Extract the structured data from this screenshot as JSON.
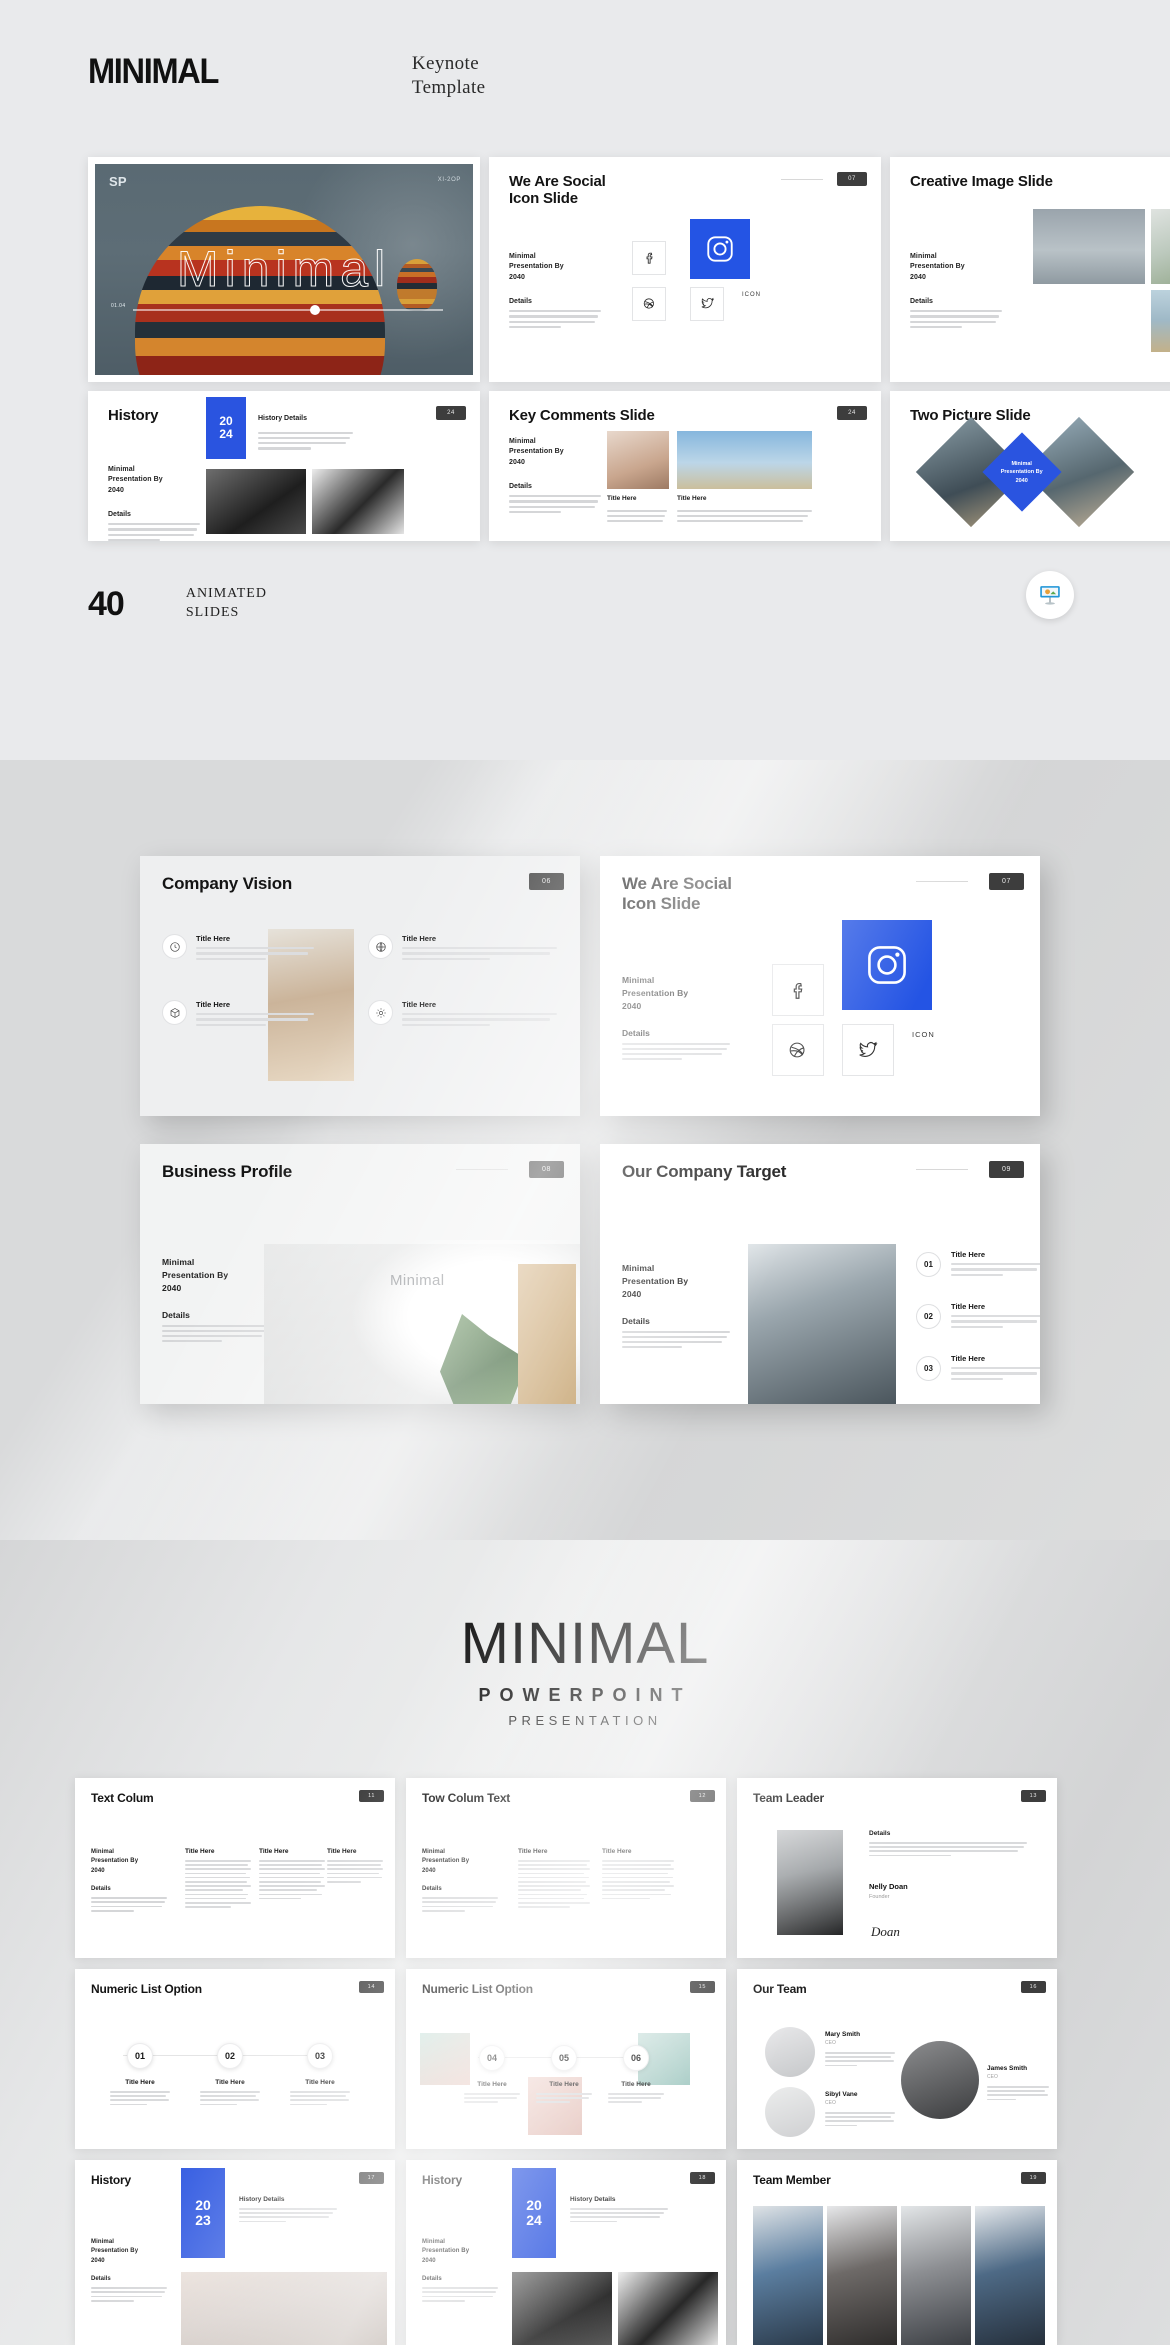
{
  "brand": {
    "wordmark": "MINIMAL",
    "subtitle_line1": "Keynote",
    "subtitle_line2": "Template"
  },
  "keynote_section": {
    "cover": {
      "tag": "SP",
      "code": "XI-2OP",
      "word": "Minimal",
      "slider_label": "01.04"
    },
    "footer": {
      "count": "40",
      "label_line1": "ANIMATED",
      "label_line2": "SLIDES",
      "app_icon": "keynote-app-icon"
    },
    "slides": [
      {
        "title_line1": "We Are Social",
        "title_line2": "Icon Slide",
        "number": "07",
        "meta_by": "Minimal\nPresentation By\n2040",
        "meta_details": "Details",
        "icon_label": "ICON",
        "icons": [
          "facebook-icon",
          "instagram-icon",
          "dribbble-icon",
          "twitter-icon"
        ]
      },
      {
        "title_line1": "Creative Image Slide",
        "title_line2": "",
        "number": "",
        "meta_by": "Minimal\nPresentation By\n2040",
        "meta_details": "Details"
      },
      {
        "title_line1": "History",
        "title_line2": "",
        "number": "24",
        "year_top": "20",
        "year_bottom": "24",
        "detail_title": "History Details",
        "meta_by": "Minimal\nPresentation By\n2040",
        "meta_details": "Details"
      },
      {
        "title_line1": "Key Comments Slide",
        "title_line2": "",
        "number": "24",
        "meta_by": "Minimal\nPresentation By\n2040",
        "meta_details": "Details",
        "caption_left": "Title Here",
        "caption_right": "Title Here"
      },
      {
        "title_line1": "Two Picture Slide",
        "title_line2": "",
        "number": "",
        "diamond_label": "Minimal\nPresentation By\n2040"
      }
    ]
  },
  "mockup_section": {
    "cards": [
      {
        "title": "Company Vision",
        "number": "06",
        "features": [
          {
            "icon": "clock-icon",
            "title": "Title Here"
          },
          {
            "icon": "globe-icon",
            "title": "Title Here"
          },
          {
            "icon": "box-icon",
            "title": "Title Here"
          },
          {
            "icon": "gear-icon",
            "title": "Title Here"
          }
        ]
      },
      {
        "title_line1": "We Are Social",
        "title_line2": "Icon Slide",
        "number": "07",
        "meta_by": "Minimal\nPresentation By\n2040",
        "meta_details": "Details",
        "icon_label": "ICON",
        "icons": [
          "facebook-icon",
          "instagram-icon",
          "dribbble-icon",
          "twitter-icon"
        ]
      },
      {
        "title": "Business Profile",
        "number": "08",
        "meta_by": "Minimal\nPresentation By\n2040",
        "meta_details": "Details",
        "watermark": "Minimal"
      },
      {
        "title": "Our Company Target",
        "number": "09",
        "meta_by": "Minimal\nPresentation By\n2040",
        "meta_details": "Details",
        "rows": [
          {
            "num": "01",
            "title": "Title Here"
          },
          {
            "num": "02",
            "title": "Title Here"
          },
          {
            "num": "03",
            "title": "Title Here"
          }
        ]
      }
    ]
  },
  "powerpoint_section": {
    "title": "MINIMAL",
    "subtitle1": "POWERPOINT",
    "subtitle2": "PRESENTATION",
    "slides": [
      {
        "title": "Text Colum",
        "number": "11",
        "meta_by": "Minimal\nPresentation By\n2040",
        "meta_details": "Details",
        "columns": [
          "Title Here",
          "Title Here",
          "Title Here"
        ]
      },
      {
        "title": "Tow Colum Text",
        "number": "12",
        "meta_by": "Minimal\nPresentation By\n2040",
        "meta_details": "Details",
        "columns": [
          "Title Here",
          "Title Here"
        ]
      },
      {
        "title": "Team Leader",
        "number": "13",
        "details_label": "Details",
        "person_name": "Nelly Doan",
        "person_role": "Founder",
        "signature": "Doan"
      },
      {
        "title": "Numeric List Option",
        "number": "14",
        "nodes": [
          {
            "num": "01",
            "title": "Title Here"
          },
          {
            "num": "02",
            "title": "Title Here"
          },
          {
            "num": "03",
            "title": "Title Here"
          }
        ]
      },
      {
        "title": "Numeric List Option",
        "number": "15",
        "nodes": [
          {
            "num": "04",
            "title": "Title Here"
          },
          {
            "num": "05",
            "title": "Title Here"
          },
          {
            "num": "06",
            "title": "Title Here"
          }
        ]
      },
      {
        "title": "Our Team",
        "number": "16",
        "members": [
          {
            "name": "Mary Smith",
            "role": "CEO"
          },
          {
            "name": "Sibyl Vane",
            "role": "CEO"
          },
          {
            "name": "James Smith",
            "role": "CEO"
          }
        ]
      },
      {
        "title": "History",
        "number": "17",
        "year_top": "20",
        "year_bottom": "23",
        "detail_title": "History Details",
        "meta_by": "Minimal\nPresentation By\n2040",
        "meta_details": "Details"
      },
      {
        "title": "History",
        "number": "18",
        "year_top": "20",
        "year_bottom": "24",
        "detail_title": "History Details",
        "meta_by": "Minimal\nPresentation By\n2040",
        "meta_details": "Details"
      },
      {
        "title": "Team Member",
        "number": "19"
      }
    ]
  },
  "colors": {
    "accent_blue": "#2a54e0",
    "badge_dark": "#3d3d3d",
    "page_bg": "#e9eaec",
    "cover_bg": "#5a6a73"
  }
}
